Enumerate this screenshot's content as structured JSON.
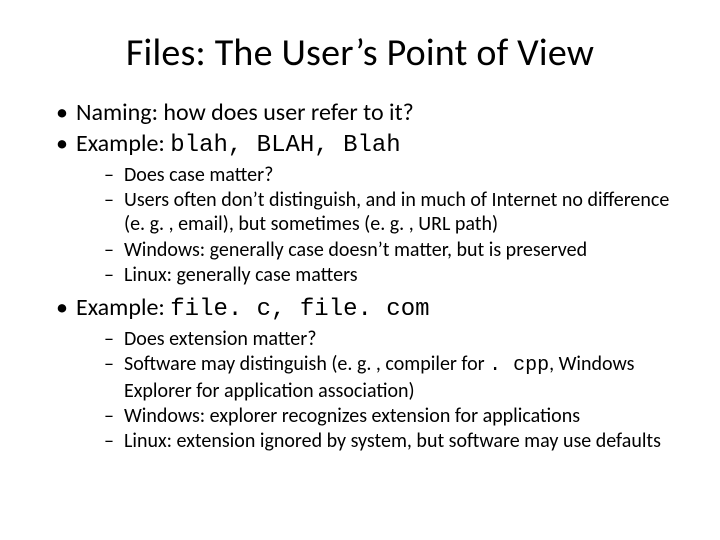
{
  "title": "Files: The User’s Point of View",
  "b1": {
    "text": "Naming: how does user refer to it?"
  },
  "b2": {
    "prefix": "Example: ",
    "code": "blah, BLAH, Blah",
    "sub": [
      "Does case matter?",
      "Users often don’t distinguish, and in much of Internet no difference (e. g. , email), but sometimes (e. g. , URL path)",
      "Windows: generally case doesn’t matter, but is preserved",
      "Linux: generally case matters"
    ]
  },
  "b3": {
    "prefix": "Example: ",
    "code": "file. c, file. com",
    "sub1": "Does extension matter?",
    "sub2a": "Software may distinguish (e. g. , compiler for ",
    "sub2code": ". cpp",
    "sub2b": ", Windows Explorer for application association)",
    "sub3": "Windows: explorer recognizes extension for applications",
    "sub4": "Linux: extension ignored by system, but software may use defaults"
  }
}
